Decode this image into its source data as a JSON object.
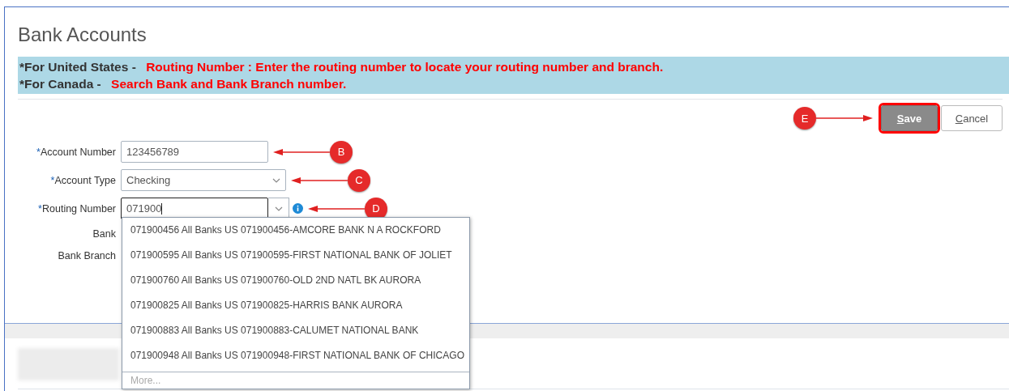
{
  "title": "Bank Accounts",
  "notices": [
    {
      "lead": "*For United States - ",
      "text": "Routing Number : Enter the routing number to locate your routing number and branch."
    },
    {
      "lead": "*For Canada - ",
      "text": "Search Bank and Bank Branch number."
    }
  ],
  "buttons": [
    {
      "label": "Save",
      "kind": "primary",
      "highlighted": true
    },
    {
      "label": "Cancel",
      "kind": "secondary",
      "highlighted": false
    }
  ],
  "fields": [
    {
      "label": "Account Number",
      "required_mark": "*",
      "kind": "text",
      "value": "123456789",
      "callout": "B",
      "focused": false
    },
    {
      "label": "Account Type",
      "required_mark": "*",
      "kind": "select",
      "value": "Checking",
      "callout": "C",
      "focused": false
    },
    {
      "label": "Routing Number",
      "required_mark": "*",
      "kind": "combo",
      "value": "071900",
      "callout": "D",
      "focused": true
    },
    {
      "label": "Bank",
      "kind": "readonly"
    },
    {
      "label": "Bank Branch",
      "kind": "readonly"
    }
  ],
  "save_callout": "E",
  "dropdown": {
    "options": [
      "071900456 All Banks US 071900456-AMCORE BANK N A ROCKFORD",
      "071900595 All Banks US 071900595-FIRST NATIONAL BANK OF JOLIET",
      "071900760 All Banks US 071900760-OLD 2ND NATL BK AURORA",
      "071900825 All Banks US 071900825-HARRIS BANK AURORA",
      "071900883 All Banks US 071900883-CALUMET NATIONAL BANK",
      "071900948 All Banks US 071900948-FIRST NATIONAL BANK OF CHICAGO"
    ],
    "more": "More..."
  }
}
